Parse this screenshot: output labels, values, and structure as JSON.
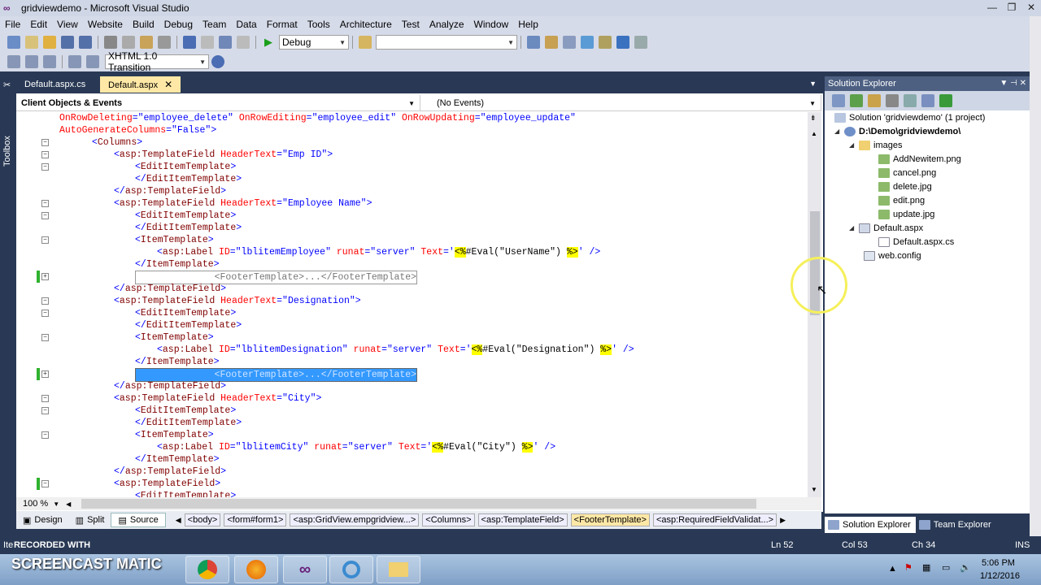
{
  "window": {
    "title": "gridviewdemo - Microsoft Visual Studio"
  },
  "menu": [
    "File",
    "Edit",
    "View",
    "Website",
    "Build",
    "Debug",
    "Team",
    "Data",
    "Format",
    "Tools",
    "Architecture",
    "Test",
    "Analyze",
    "Window",
    "Help"
  ],
  "toolbar": {
    "config_value": "Debug",
    "platform_value": "",
    "doctype_value": "XHTML 1.0 Transition"
  },
  "toolbox": {
    "label": "Toolbox"
  },
  "tabs": [
    {
      "label": "Default.aspx.cs"
    },
    {
      "label": "Default.aspx"
    }
  ],
  "navbar": {
    "left": "Client Objects & Events",
    "right": "(No Events)"
  },
  "code_lines": [
    "      OnRowDeleting=\"employee_delete\" OnRowEditing=\"employee_edit\" OnRowUpdating=\"employee_update\"",
    "      AutoGenerateColumns=\"False\">",
    "      <Columns>",
    "          <asp:TemplateField HeaderText=\"Emp ID\">",
    "              <EditItemTemplate>",
    "              </EditItemTemplate>",
    "          </asp:TemplateField>",
    "          <asp:TemplateField HeaderText=\"Employee Name\">",
    "              <EditItemTemplate>",
    "              </EditItemTemplate>",
    "              <ItemTemplate>",
    "                  <asp:Label ID=\"lblitemEmployee\" runat=\"server\" Text='<%#Eval(\"UserName\") %>' />",
    "              </ItemTemplate>",
    "              <FooterTemplate>...</FooterTemplate>",
    "          </asp:TemplateField>",
    "          <asp:TemplateField HeaderText=\"Designation\">",
    "              <EditItemTemplate>",
    "              </EditItemTemplate>",
    "              <ItemTemplate>",
    "                  <asp:Label ID=\"lblitemDesignation\" runat=\"server\" Text='<%#Eval(\"Designation\") %>' />",
    "              </ItemTemplate>",
    "              <FooterTemplate>...</FooterTemplate>",
    "          </asp:TemplateField>",
    "          <asp:TemplateField HeaderText=\"City\">",
    "              <EditItemTemplate>",
    "              </EditItemTemplate>",
    "              <ItemTemplate>",
    "                  <asp:Label ID=\"lblitemCity\" runat=\"server\" Text='<%#Eval(\"City\") %>' />",
    "              </ItemTemplate>",
    "          </asp:TemplateField>",
    "          <asp:TemplateField>",
    "              <EditItemTemplate>"
  ],
  "editor": {
    "zoom": "100 %"
  },
  "bottom_bar": {
    "design": "Design",
    "split": "Split",
    "source": "Source",
    "crumbs": [
      "<body>",
      "<form#form1>",
      "<asp:GridView.empgridview...>",
      "<Columns>",
      "<asp:TemplateField>",
      "<FooterTemplate>",
      "<asp:RequiredFieldValidat...>"
    ]
  },
  "solution_explorer": {
    "title": "Solution Explorer",
    "tree": [
      {
        "label": "Solution 'gridviewdemo' (1 project)",
        "depth": 0
      },
      {
        "label": "D:\\Demo\\gridviewdemo\\",
        "depth": 1
      },
      {
        "label": "images",
        "depth": 2
      },
      {
        "label": "AddNewitem.png",
        "depth": 3
      },
      {
        "label": "cancel.png",
        "depth": 3
      },
      {
        "label": "delete.jpg",
        "depth": 3
      },
      {
        "label": "edit.png",
        "depth": 3
      },
      {
        "label": "update.jpg",
        "depth": 3
      },
      {
        "label": "Default.aspx",
        "depth": 2
      },
      {
        "label": "Default.aspx.cs",
        "depth": 3
      },
      {
        "label": "web.config",
        "depth": 2
      }
    ],
    "tabs": [
      "Solution Explorer",
      "Team Explorer"
    ]
  },
  "status": {
    "left": "Ite",
    "ln": "Ln 52",
    "col": "Col 53",
    "ch": "Ch 34",
    "mode": "INS"
  },
  "watermark": {
    "recorded": "RECORDED WITH",
    "brand": "SCREENCAST MATIC"
  },
  "taskbar": {
    "time": "5:06 PM",
    "date": "1/12/2016"
  }
}
